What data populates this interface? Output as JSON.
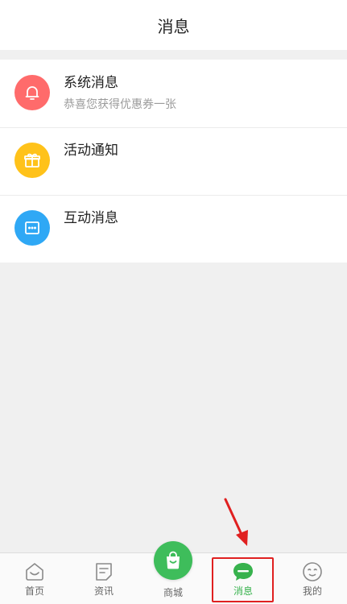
{
  "header": {
    "title": "消息"
  },
  "messages": [
    {
      "name": "系统消息",
      "subtitle": "恭喜您获得优惠券一张",
      "icon": "bell-icon",
      "color": "#ff6b6b"
    },
    {
      "name": "活动通知",
      "subtitle": "",
      "icon": "gift-icon",
      "color": "#ffc21a"
    },
    {
      "name": "互动消息",
      "subtitle": "",
      "icon": "chat-dots-icon",
      "color": "#2fa8f5"
    }
  ],
  "tabbar": {
    "home": "首页",
    "news": "资讯",
    "shop": "商城",
    "messages": "消息",
    "mine": "我的",
    "active": "消息",
    "active_color": "#37b24d"
  },
  "annotation": {
    "highlight_color": "#e02020"
  }
}
